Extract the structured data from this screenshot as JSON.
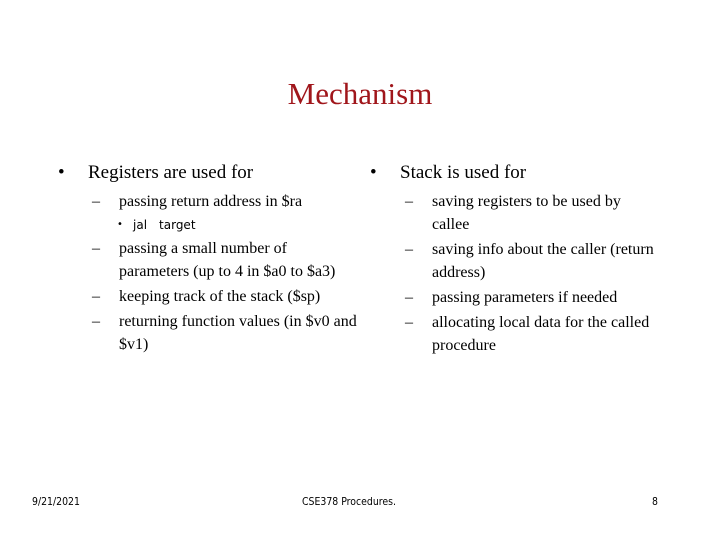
{
  "slide": {
    "title": "Mechanism",
    "title_color": "#a0161b",
    "left_column": {
      "bullet": "Registers are used for",
      "items": [
        {
          "text": "passing return address in $ra",
          "sub_items": [
            {
              "code": "jal",
              "arg": "target"
            }
          ]
        },
        {
          "text": "passing a small number of parameters (up to 4 in $a0 to $a3)"
        },
        {
          "text": "keeping track of the stack ($sp)"
        },
        {
          "text": "returning function values (in $v0 and $v1)"
        }
      ]
    },
    "right_column": {
      "bullet": "Stack is used for",
      "items": [
        {
          "text": "saving registers to be used by callee"
        },
        {
          "text": "saving info about the caller (return address)"
        },
        {
          "text": "passing parameters if needed"
        },
        {
          "text": "allocating local data for the called procedure"
        }
      ]
    },
    "footer": {
      "date": "9/21/2021",
      "center": "CSE378 Procedures.",
      "page_number": "8"
    },
    "glyphs": {
      "bullet": "•",
      "dash": "–",
      "small_bullet": "•"
    }
  }
}
